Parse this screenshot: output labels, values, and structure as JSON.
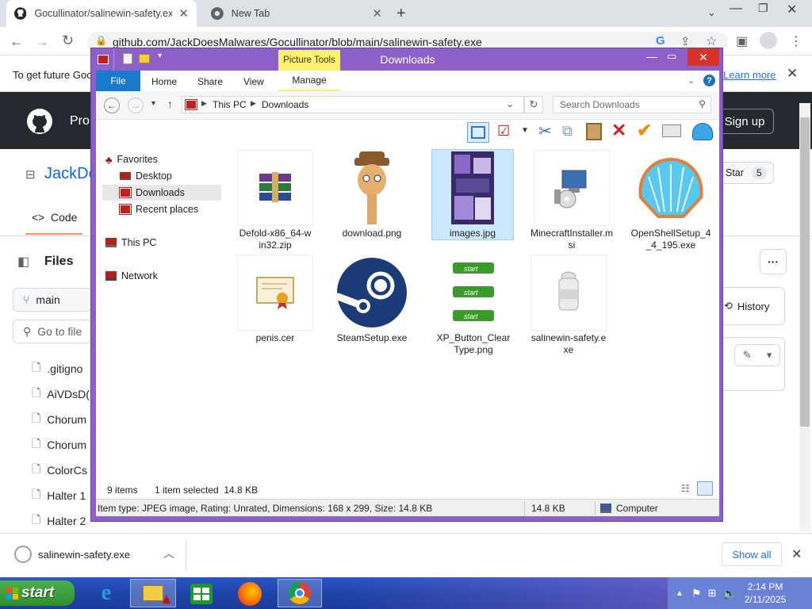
{
  "browser": {
    "tabs": [
      {
        "title": "Gocullinator/salinewin-safety.exe",
        "icon": "github-icon"
      },
      {
        "title": "New Tab",
        "icon": "chrome-icon"
      }
    ],
    "new_tab": "+",
    "url": "github.com/JackDoesMalwares/Gocullinator/blob/main/salinewin-safety.exe",
    "window_controls": [
      "chevron-down-icon",
      "minimize-icon",
      "restore-icon",
      "close-icon"
    ]
  },
  "infobar": {
    "text": "To get future Goo",
    "link": "Learn more"
  },
  "github": {
    "header_partial": "Pro",
    "signup": "Sign up",
    "repo_partial": "JackDo",
    "star_label": "Star",
    "star_count": "5",
    "code_tab": "Code",
    "files_title": "Files",
    "branch": "main",
    "goto_placeholder": "Go to file",
    "history": "History",
    "more": "···",
    "files": [
      ".gitigno",
      "AiVDsD(",
      "Chorum",
      "Chorum",
      "ColorCs",
      "Halter 1",
      "Halter 2"
    ]
  },
  "explorer": {
    "title": "Downloads",
    "context_tab": "Picture Tools",
    "ribbon_tabs": [
      "File",
      "Home",
      "Share",
      "View",
      "Manage"
    ],
    "breadcrumb": [
      "This PC",
      "Downloads"
    ],
    "search_placeholder": "Search Downloads",
    "nav": {
      "favorites": "Favorites",
      "favorites_items": [
        "Desktop",
        "Downloads",
        "Recent places"
      ],
      "this_pc": "This PC",
      "network": "Network"
    },
    "files": [
      {
        "name": "Defold-x86_64-win32.zip",
        "icon": "winrar-archive-icon"
      },
      {
        "name": "download.png",
        "icon": "character-image-icon"
      },
      {
        "name": "images.jpg",
        "icon": "photo-collage-icon",
        "selected": true
      },
      {
        "name": "MinecraftInstaller.msi",
        "icon": "installer-icon"
      },
      {
        "name": "OpenShellSetup_4_4_195.exe",
        "icon": "shell-icon"
      },
      {
        "name": "penis.cer",
        "icon": "certificate-icon"
      },
      {
        "name": "SteamSetup.exe",
        "icon": "steam-icon"
      },
      {
        "name": "XP_Button_ClearType.png",
        "icon": "xp-start-buttons-icon"
      },
      {
        "name": "salinewin-safety.exe",
        "icon": "bottle-icon"
      }
    ],
    "status_count": "9 items",
    "status_selected": "1 item selected  14.8 KB",
    "detail_text": "Item type: JPEG image, Rating: Unrated, Dimensions: 168 x 299, Size: 14.8 KB",
    "detail_size": "14.8 KB",
    "detail_location": "Computer"
  },
  "download_shelf": {
    "file": "salinewin-safety.exe",
    "show_all": "Show all"
  },
  "taskbar": {
    "start": "start",
    "apps": [
      "internet-explorer-icon",
      "file-explorer-icon",
      "store-icon",
      "firefox-icon",
      "chrome-icon"
    ],
    "time": "2:14 PM",
    "date": "2/11/2025"
  },
  "colors": {
    "explorer_frame": "#8c60c8",
    "taskbar": "#1f43a8",
    "github_header": "#24292f",
    "file_tab": "#1979ca"
  }
}
